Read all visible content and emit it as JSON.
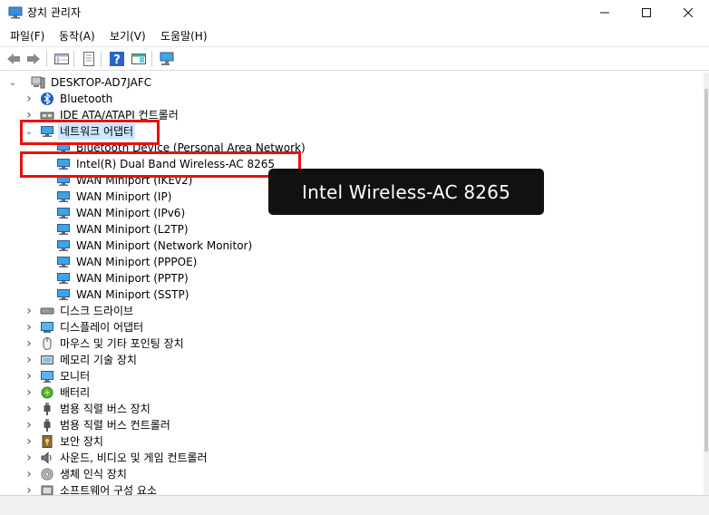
{
  "window": {
    "title": "장치 관리자"
  },
  "menu": [
    "파일(F)",
    "동작(A)",
    "보기(V)",
    "도움말(H)"
  ],
  "tree": {
    "root": "DESKTOP-AD7JAFC",
    "items": [
      {
        "label": "Bluetooth",
        "icon": "bluetooth-icon"
      },
      {
        "label": "IDE ATA/ATAPI 컨트롤러",
        "icon": "ide-controller-icon"
      },
      {
        "label": "네트워크 어댑터",
        "icon": "network-adapter-icon",
        "expanded": true,
        "children": [
          "Bluetooth Device (Personal Area Network)",
          "Intel(R) Dual Band Wireless-AC 8265",
          "WAN Miniport (IKEv2)",
          "WAN Miniport (IP)",
          "WAN Miniport (IPv6)",
          "WAN Miniport (L2TP)",
          "WAN Miniport (Network Monitor)",
          "WAN Miniport (PPPOE)",
          "WAN Miniport (PPTP)",
          "WAN Miniport (SSTP)"
        ]
      },
      {
        "label": "디스크 드라이브",
        "icon": "disk-drive-icon"
      },
      {
        "label": "디스플레이 어댑터",
        "icon": "display-adapter-icon"
      },
      {
        "label": "마우스 및 기타 포인팅 장치",
        "icon": "mouse-icon"
      },
      {
        "label": "메모리 기술 장치",
        "icon": "memory-icon"
      },
      {
        "label": "모니터",
        "icon": "monitor-icon"
      },
      {
        "label": "배터리",
        "icon": "battery-icon"
      },
      {
        "label": "범용 직렬 버스 장치",
        "icon": "usb-icon"
      },
      {
        "label": "범용 직렬 버스 컨트롤러",
        "icon": "usb-icon"
      },
      {
        "label": "보안 장치",
        "icon": "security-icon"
      },
      {
        "label": "사운드, 비디오 및 게임 컨트롤러",
        "icon": "speaker-icon"
      },
      {
        "label": "생체 인식 장치",
        "icon": "fingerprint-icon"
      },
      {
        "label": "소프트웨어 구성 요소",
        "icon": "software-component-icon"
      }
    ]
  },
  "callout": "Intel Wireless-AC 8265",
  "colors": {
    "highlight": "#e8110d",
    "selection": "#cce8ff",
    "callout_bg": "#111111"
  }
}
